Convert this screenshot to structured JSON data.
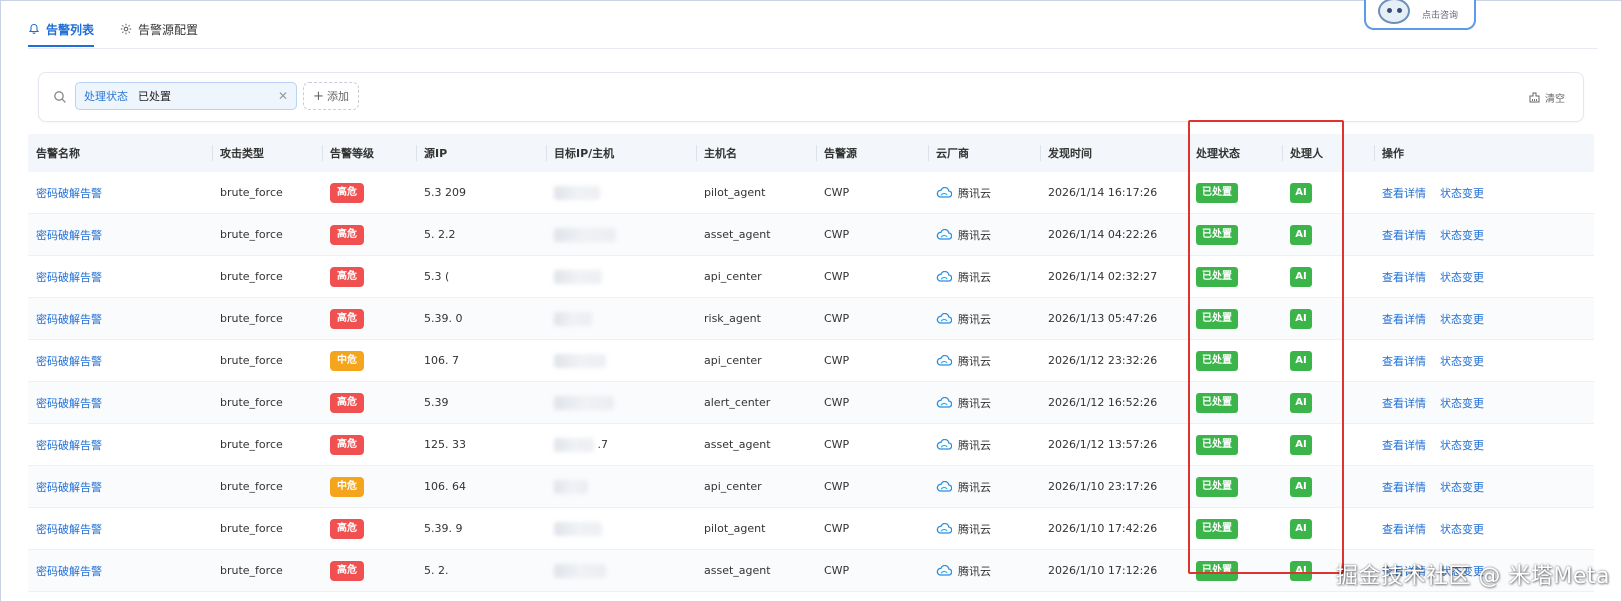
{
  "tabs": [
    {
      "label": "告警列表",
      "icon": "bell-icon",
      "active": true
    },
    {
      "label": "告警源配置",
      "icon": "gear-icon",
      "active": false
    }
  ],
  "assistant": {
    "label": "点击咨询"
  },
  "filter": {
    "key": "处理状态",
    "value": "已处置",
    "add_label": "添加",
    "clear_label": "清空"
  },
  "columns": [
    "告警名称",
    "攻击类型",
    "告警等级",
    "源IP",
    "目标IP/主机",
    "主机名",
    "告警源",
    "云厂商",
    "发现时间",
    "处理状态",
    "处理人",
    "操作"
  ],
  "colors": {
    "high": "#f0504f",
    "medium": "#f5a51b",
    "ok": "#3bb54a",
    "link": "#1f6fd6",
    "highlight": "#e0322e"
  },
  "rows": [
    {
      "name": "密码破解告警",
      "type": "brute_force",
      "level": "高危",
      "level_kind": "high",
      "src": "5.3  209",
      "dst": "",
      "host": "pilot_agent",
      "source": "CWP",
      "cloud": "腾讯云",
      "time": "2026/1/14 16:17:26",
      "status": "已处置",
      "handler": "AI",
      "op1": "查看详情",
      "op2": "状态变更"
    },
    {
      "name": "密码破解告警",
      "type": "brute_force",
      "level": "高危",
      "level_kind": "high",
      "src": "5.  2.2",
      "dst": "",
      "host": "asset_agent",
      "source": "CWP",
      "cloud": "腾讯云",
      "time": "2026/1/14 04:22:26",
      "status": "已处置",
      "handler": "AI",
      "op1": "查看详情",
      "op2": "状态变更"
    },
    {
      "name": "密码破解告警",
      "type": "brute_force",
      "level": "高危",
      "level_kind": "high",
      "src": "5.3  (",
      "dst": "",
      "host": "api_center",
      "source": "CWP",
      "cloud": "腾讯云",
      "time": "2026/1/14 02:32:27",
      "status": "已处置",
      "handler": "AI",
      "op1": "查看详情",
      "op2": "状态变更"
    },
    {
      "name": "密码破解告警",
      "type": "brute_force",
      "level": "高危",
      "level_kind": "high",
      "src": "5.39.  0",
      "dst": "",
      "host": "risk_agent",
      "source": "CWP",
      "cloud": "腾讯云",
      "time": "2026/1/13 05:47:26",
      "status": "已处置",
      "handler": "AI",
      "op1": "查看详情",
      "op2": "状态变更"
    },
    {
      "name": "密码破解告警",
      "type": "brute_force",
      "level": "中危",
      "level_kind": "medium",
      "src": "106.  7",
      "dst": "",
      "host": "api_center",
      "source": "CWP",
      "cloud": "腾讯云",
      "time": "2026/1/12 23:32:26",
      "status": "已处置",
      "handler": "AI",
      "op1": "查看详情",
      "op2": "状态变更"
    },
    {
      "name": "密码破解告警",
      "type": "brute_force",
      "level": "高危",
      "level_kind": "high",
      "src": "5.39",
      "dst": "",
      "host": "alert_center",
      "source": "CWP",
      "cloud": "腾讯云",
      "time": "2026/1/12 16:52:26",
      "status": "已处置",
      "handler": "AI",
      "op1": "查看详情",
      "op2": "状态变更"
    },
    {
      "name": "密码破解告警",
      "type": "brute_force",
      "level": "高危",
      "level_kind": "high",
      "src": "125.  33",
      "dst": "  .7",
      "host": "asset_agent",
      "source": "CWP",
      "cloud": "腾讯云",
      "time": "2026/1/12 13:57:26",
      "status": "已处置",
      "handler": "AI",
      "op1": "查看详情",
      "op2": "状态变更"
    },
    {
      "name": "密码破解告警",
      "type": "brute_force",
      "level": "中危",
      "level_kind": "medium",
      "src": "106.  64",
      "dst": "",
      "host": "api_center",
      "source": "CWP",
      "cloud": "腾讯云",
      "time": "2026/1/10 23:17:26",
      "status": "已处置",
      "handler": "AI",
      "op1": "查看详情",
      "op2": "状态变更"
    },
    {
      "name": "密码破解告警",
      "type": "brute_force",
      "level": "高危",
      "level_kind": "high",
      "src": "5.39.  9",
      "dst": "",
      "host": "pilot_agent",
      "source": "CWP",
      "cloud": "腾讯云",
      "time": "2026/1/10 17:42:26",
      "status": "已处置",
      "handler": "AI",
      "op1": "查看详情",
      "op2": "状态变更"
    },
    {
      "name": "密码破解告警",
      "type": "brute_force",
      "level": "高危",
      "level_kind": "high",
      "src": "5.  2.",
      "dst": "",
      "host": "asset_agent",
      "source": "CWP",
      "cloud": "腾讯云",
      "time": "2026/1/10 17:12:26",
      "status": "已处置",
      "handler": "AI",
      "op1": "查看详情",
      "op2": "状态变更"
    }
  ],
  "watermark": "掘金技术社区 @ 米塔Meta"
}
